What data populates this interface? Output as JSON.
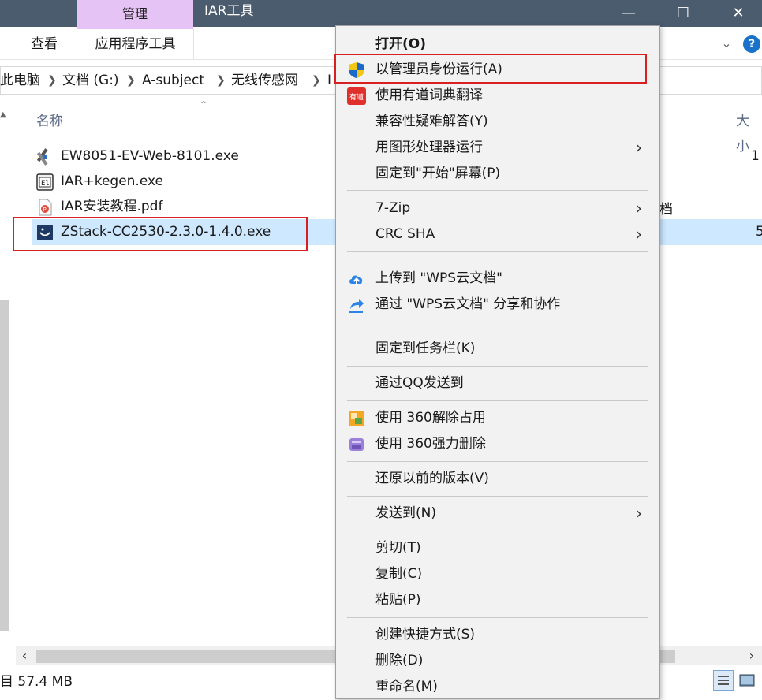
{
  "titlebar": {
    "manage_tab": "管理",
    "title": "IAR工具",
    "minimize_glyph": "—",
    "maximize_glyph": "☐",
    "close_glyph": "✕"
  },
  "ribbon": {
    "tabs": [
      "查看",
      "应用程序工具"
    ],
    "help": "?"
  },
  "address": {
    "crumbs": [
      "此电脑",
      "文档 (G:)",
      "A-subject",
      "无线传感网",
      "I"
    ]
  },
  "columns": {
    "name": "名称",
    "size": "大小"
  },
  "files": [
    {
      "name": "EW8051-EV-Web-8101.exe",
      "icon": "installer-icon"
    },
    {
      "name": "IAR+kegen.exe",
      "icon": "exe-icon"
    },
    {
      "name": "IAR安装教程.pdf",
      "icon": "pdf-icon"
    },
    {
      "name": "ZStack-CC2530-2.3.0-1.4.0.exe",
      "icon": "zstack-icon",
      "selected": true
    }
  ],
  "right_fragments": {
    "row1": "1",
    "row3": "档",
    "row4": "5"
  },
  "status": {
    "text": "目 57.4 MB"
  },
  "context_menu": {
    "items": [
      {
        "label": "打开(O)",
        "bold": true
      },
      {
        "label": "以管理员身份运行(A)",
        "icon": "uac-shield-icon"
      },
      {
        "label": "使用有道词典翻译",
        "icon": "youdao-icon"
      },
      {
        "label": "兼容性疑难解答(Y)"
      },
      {
        "label": "用图形处理器运行",
        "submenu": true
      },
      {
        "label": "固定到\"开始\"屏幕(P)"
      },
      {
        "label": "7-Zip",
        "submenu": true
      },
      {
        "label": "CRC SHA",
        "submenu": true
      },
      {
        "label": "上传到 \"WPS云文档\"",
        "icon": "cloud-upload-icon"
      },
      {
        "label": "通过 \"WPS云文档\" 分享和协作",
        "icon": "share-icon"
      },
      {
        "label": "固定到任务栏(K)"
      },
      {
        "label": "通过QQ发送到"
      },
      {
        "label": "使用 360解除占用",
        "icon": "360-unlock-icon"
      },
      {
        "label": "使用 360强力删除",
        "icon": "360-delete-icon"
      },
      {
        "label": "还原以前的版本(V)"
      },
      {
        "label": "发送到(N)",
        "submenu": true
      },
      {
        "label": "剪切(T)"
      },
      {
        "label": "复制(C)"
      },
      {
        "label": "粘贴(P)"
      },
      {
        "label": "创建快捷方式(S)"
      },
      {
        "label": "删除(D)"
      },
      {
        "label": "重命名(M)"
      }
    ],
    "submenu_glyph": "›"
  },
  "colors": {
    "titlebar": "#4b5c6f",
    "manage_tab": "#e5c3f5",
    "selection": "#cde8ff",
    "highlight_box": "#d92020",
    "menu_bg": "#f2f2f2"
  }
}
